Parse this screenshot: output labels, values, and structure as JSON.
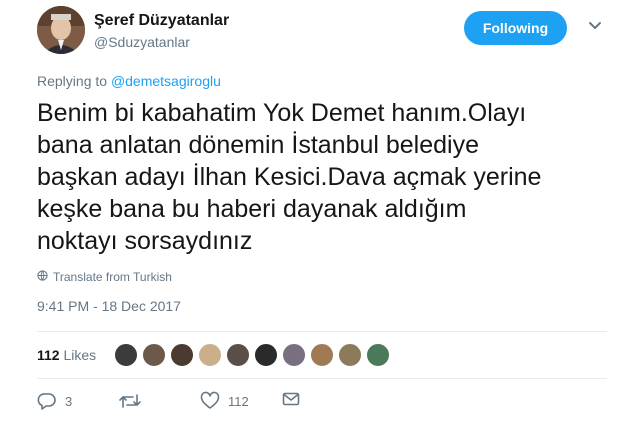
{
  "user": {
    "display_name": "Şeref Düzyatanlar",
    "handle": "@Sduzyatanlar"
  },
  "follow_button": {
    "label": "Following",
    "color": "#1da1f2"
  },
  "reply_context": {
    "prefix": "Replying to",
    "mention": "@demetsagiroglu"
  },
  "tweet": {
    "lines": [
      "Benim bi kabahatim Yok Demet hanım.Olayı",
      "bana anlatan dönemin İstanbul belediye",
      "başkan adayı İlhan Kesici.Dava açmak yerine",
      "keşke bana bu haberi dayanak aldığım",
      "noktayı sorsaydınız"
    ]
  },
  "translate": {
    "label": "Translate from Turkish",
    "icon": "globe-icon"
  },
  "timestamp": "9:41 PM - 18 Dec 2017",
  "likes": {
    "count": "112",
    "label": "Likes",
    "face_colors": [
      "#3b3b3b",
      "#6b5a4a",
      "#4a3a30",
      "#c9b08a",
      "#5a4e48",
      "#2a2a2a",
      "#7a6f7f",
      "#a07a55",
      "#8c7b5a",
      "#4a7a5a"
    ]
  },
  "actions": {
    "reply": {
      "icon": "reply-icon",
      "count": "3"
    },
    "retweet": {
      "icon": "retweet-icon",
      "count": ""
    },
    "like": {
      "icon": "heart-icon",
      "count": "112"
    },
    "message": {
      "icon": "envelope-icon",
      "count": ""
    }
  },
  "colors": {
    "text": "#14171a",
    "secondary": "#657786",
    "link": "#1da1f2",
    "divider": "#e6ecf0"
  }
}
